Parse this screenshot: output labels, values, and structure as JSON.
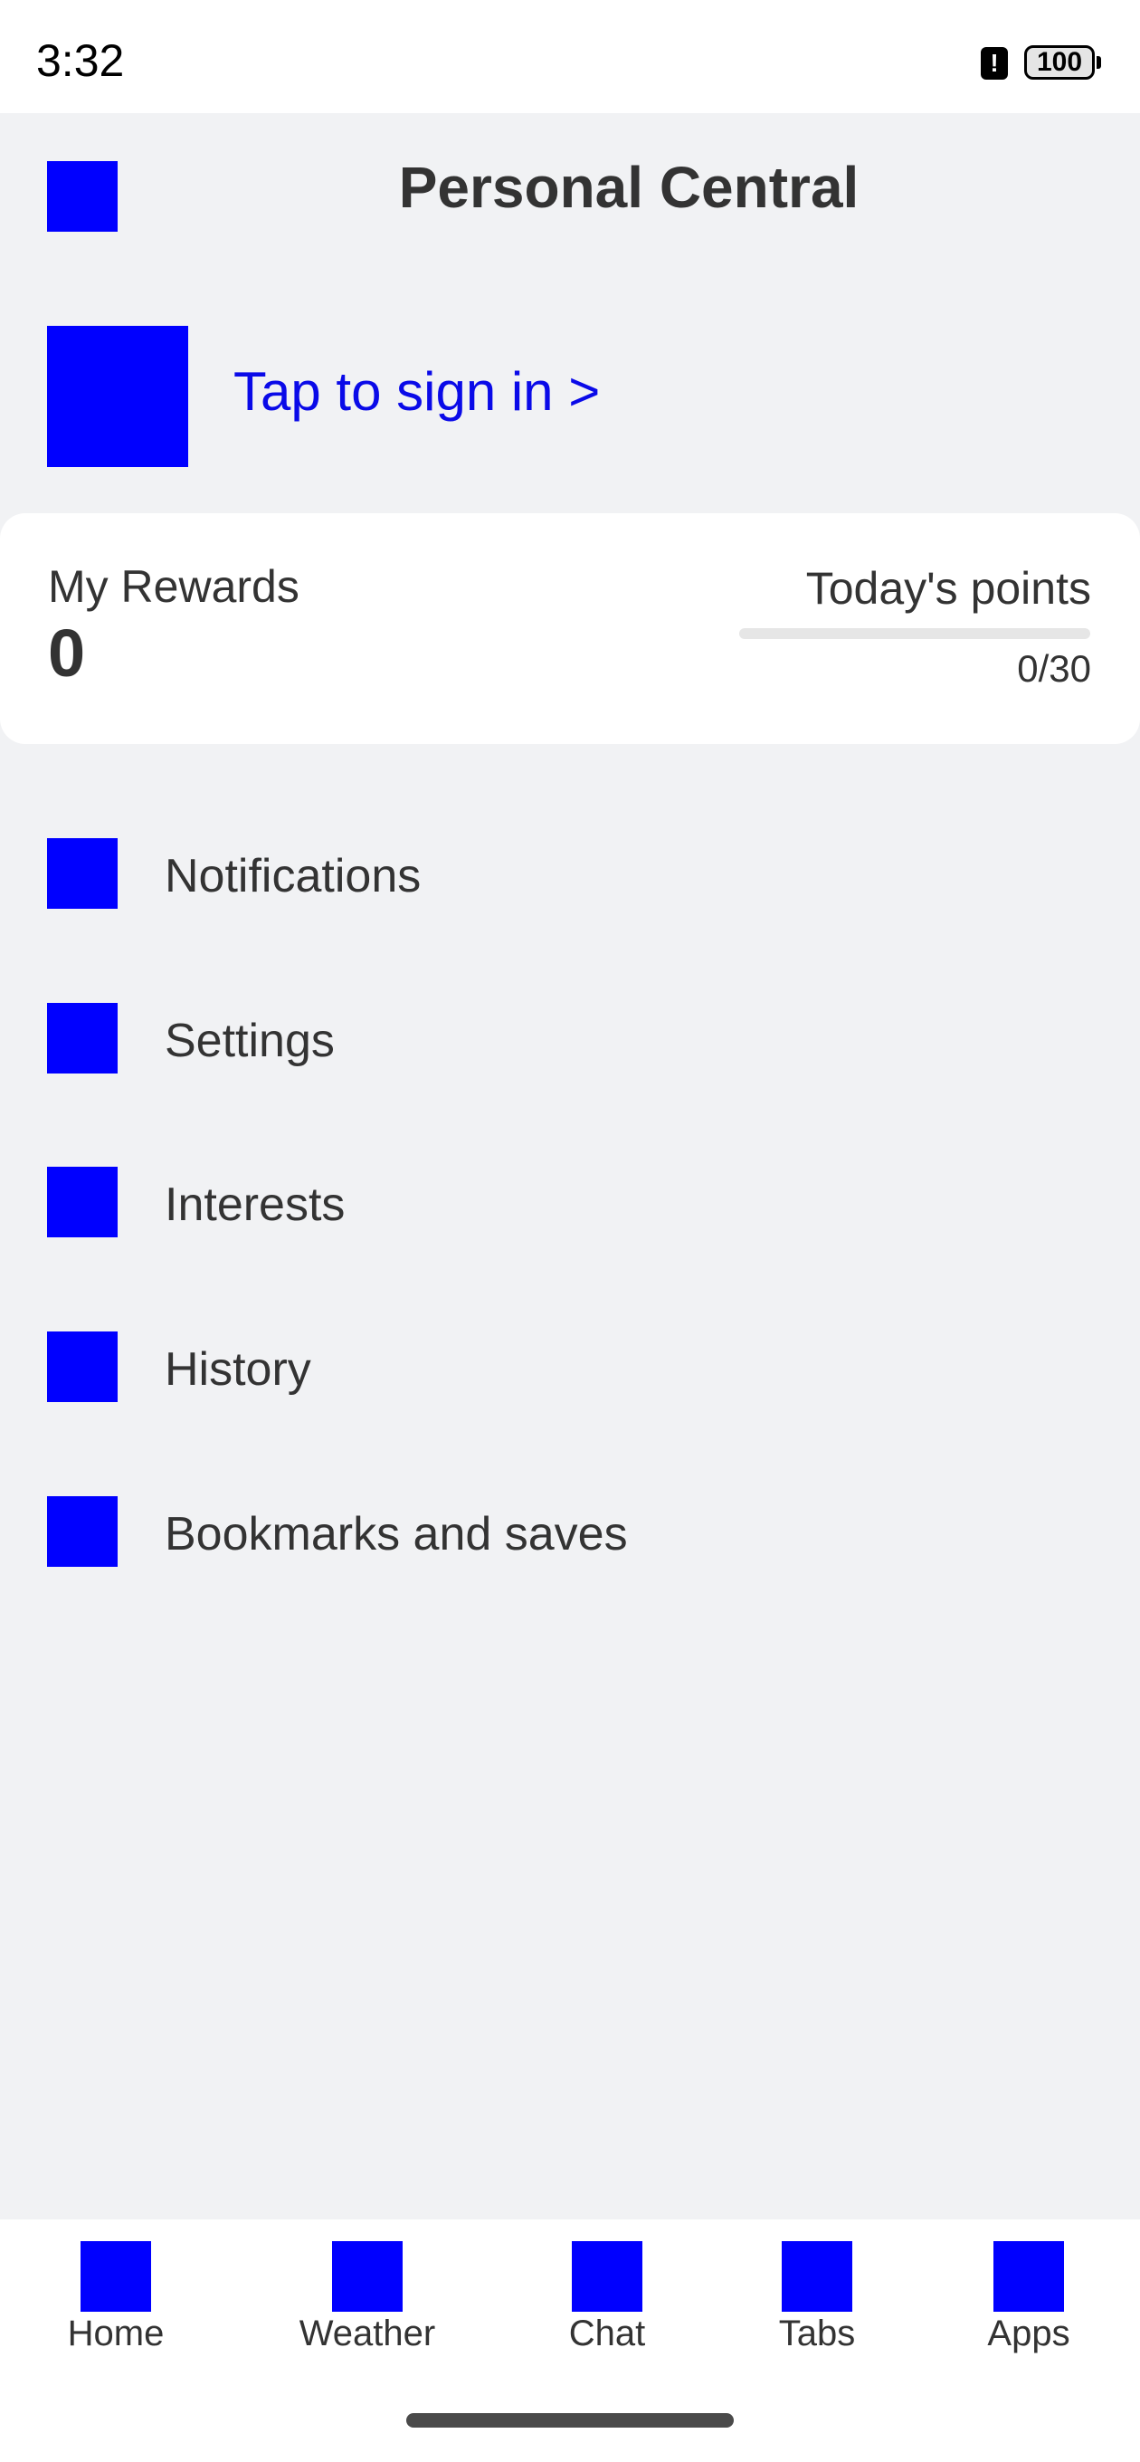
{
  "status_bar": {
    "time": "3:32",
    "alert_glyph": "!",
    "battery": "100"
  },
  "header": {
    "title": "Personal Central"
  },
  "profile": {
    "sign_in": "Tap to sign in >"
  },
  "rewards": {
    "label": "My Rewards",
    "value": "0",
    "points_label": "Today's points",
    "points_count": "0/30",
    "points_progress_fraction": 0
  },
  "menu": {
    "items": [
      {
        "label": "Notifications"
      },
      {
        "label": "Settings"
      },
      {
        "label": "Interests"
      },
      {
        "label": "History"
      },
      {
        "label": "Bookmarks and saves"
      }
    ]
  },
  "bottom_nav": {
    "items": [
      {
        "label": "Home"
      },
      {
        "label": "Weather"
      },
      {
        "label": "Chat"
      },
      {
        "label": "Tabs"
      },
      {
        "label": "Apps"
      }
    ]
  },
  "colors": {
    "accent": "#0000ff",
    "link": "#0a0ae8",
    "background": "#f1f2f4",
    "card": "#ffffff"
  }
}
